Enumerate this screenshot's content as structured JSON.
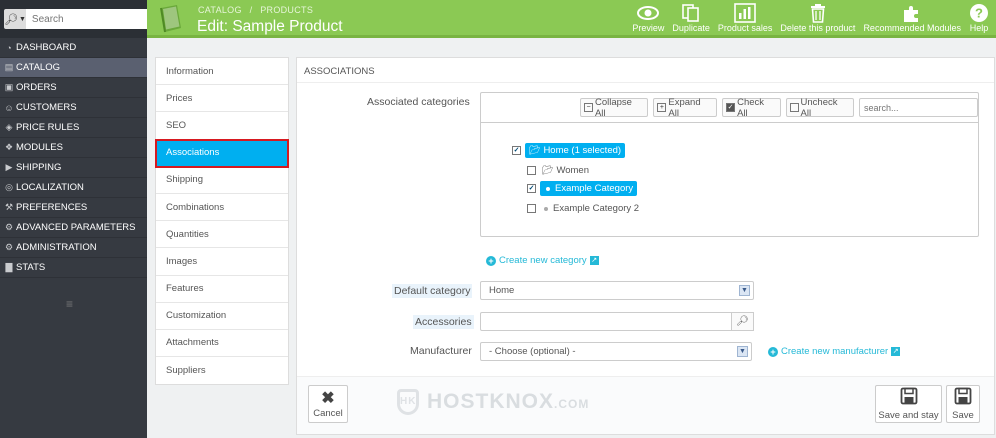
{
  "sidebar": {
    "search_placeholder": "Search",
    "items": [
      {
        "label": "DASHBOARD",
        "icon": "dashboard-icon"
      },
      {
        "label": "CATALOG",
        "icon": "catalog-icon"
      },
      {
        "label": "ORDERS",
        "icon": "orders-icon"
      },
      {
        "label": "CUSTOMERS",
        "icon": "customers-icon"
      },
      {
        "label": "PRICE RULES",
        "icon": "price-rules-icon"
      },
      {
        "label": "MODULES",
        "icon": "modules-icon"
      },
      {
        "label": "SHIPPING",
        "icon": "shipping-icon"
      },
      {
        "label": "LOCALIZATION",
        "icon": "localization-icon"
      },
      {
        "label": "PREFERENCES",
        "icon": "preferences-icon"
      },
      {
        "label": "ADVANCED PARAMETERS",
        "icon": "advanced-parameters-icon"
      },
      {
        "label": "ADMINISTRATION",
        "icon": "administration-icon"
      },
      {
        "label": "STATS",
        "icon": "stats-icon"
      }
    ],
    "active_index": 1
  },
  "header": {
    "breadcrumb_1": "CATALOG",
    "breadcrumb_sep": "/",
    "breadcrumb_2": "PRODUCTS",
    "title": "Edit: Sample Product",
    "toolbar": [
      {
        "label": "Preview",
        "icon": "eye-icon"
      },
      {
        "label": "Duplicate",
        "icon": "copy-icon"
      },
      {
        "label": "Product sales",
        "icon": "bar-chart-icon"
      },
      {
        "label": "Delete this product",
        "icon": "trash-icon"
      },
      {
        "label": "Recommended Modules",
        "icon": "puzzle-icon"
      },
      {
        "label": "Help",
        "icon": "help-icon"
      }
    ]
  },
  "tabs": [
    "Information",
    "Prices",
    "SEO",
    "Associations",
    "Shipping",
    "Combinations",
    "Quantities",
    "Images",
    "Features",
    "Customization",
    "Attachments",
    "Suppliers"
  ],
  "active_tab": "Associations",
  "panel": {
    "heading": "ASSOCIATIONS",
    "associated_categories_label": "Associated categories",
    "tree_buttons": {
      "collapse_all": "Collapse All",
      "expand_all": "Expand All",
      "check_all": "Check All",
      "uncheck_all": "Uncheck All"
    },
    "tree_search_placeholder": "search...",
    "tree": {
      "root": "Home (1 selected)",
      "women": "Women",
      "example_category": "Example Category",
      "example_category_2": "Example Category 2"
    },
    "create_category": "Create new category",
    "default_category_label": "Default category",
    "default_category_value": "Home",
    "accessories_label": "Accessories",
    "manufacturer_label": "Manufacturer",
    "manufacturer_value": "- Choose (optional) -",
    "create_manufacturer": "Create new manufacturer"
  },
  "footer": {
    "cancel": "Cancel",
    "save_and_stay": "Save and stay",
    "save": "Save"
  },
  "watermark": {
    "text": "HOSTKNOX",
    "suffix": ".COM",
    "badge": "HK"
  }
}
